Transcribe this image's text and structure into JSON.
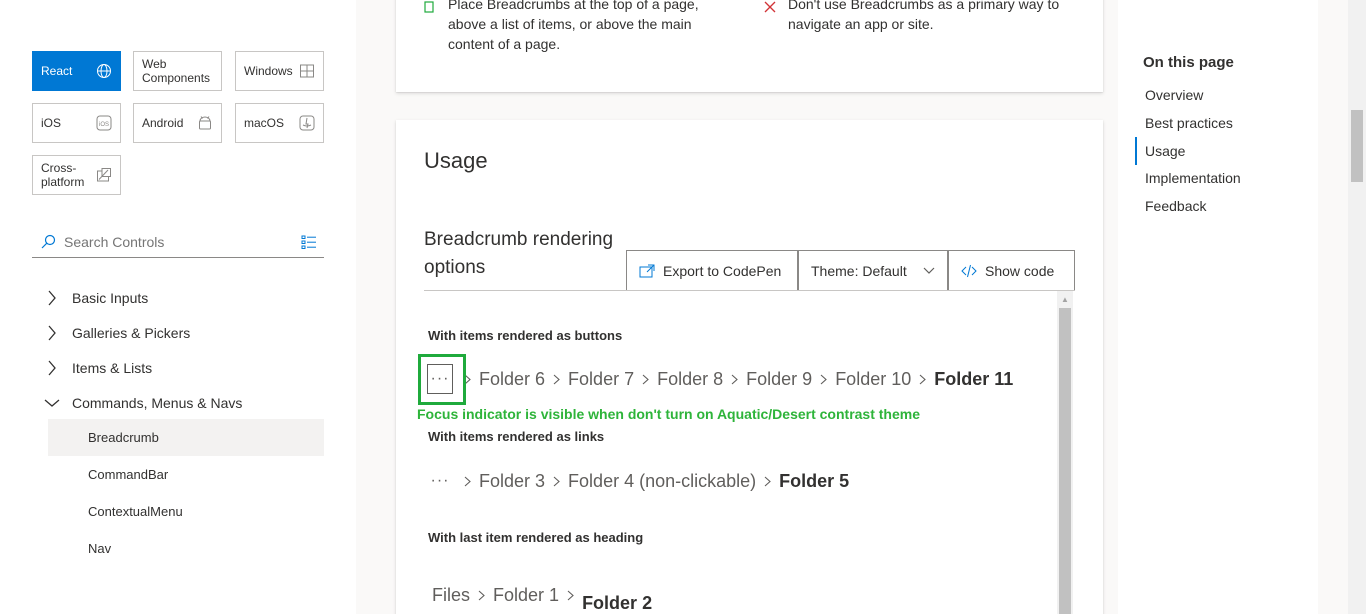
{
  "platforms": [
    {
      "label": "React",
      "icon": "globe-icon",
      "active": true
    },
    {
      "label": "Web Components",
      "icon": "",
      "active": false
    },
    {
      "label": "Windows",
      "icon": "windows-icon",
      "active": false
    },
    {
      "label": "iOS",
      "icon": "ios-icon",
      "active": false
    },
    {
      "label": "Android",
      "icon": "android-icon",
      "active": false
    },
    {
      "label": "macOS",
      "icon": "macos-icon",
      "active": false
    },
    {
      "label": "Cross-platform",
      "icon": "cross-platform-icon",
      "active": false
    }
  ],
  "search": {
    "placeholder": "Search Controls"
  },
  "categories": [
    {
      "label": "Basic Inputs",
      "expanded": false
    },
    {
      "label": "Galleries & Pickers",
      "expanded": false
    },
    {
      "label": "Items & Lists",
      "expanded": false
    },
    {
      "label": "Commands, Menus & Navs",
      "expanded": true
    }
  ],
  "sub_items": [
    "Breadcrumb",
    "CommandBar",
    "ContextualMenu",
    "Nav"
  ],
  "best_practices": {
    "do_text": "Place Breadcrumbs at the top of a page, above a list of items, or above the main content of a page.",
    "dont_text": "Don't use Breadcrumbs as a primary way to navigate an app or site."
  },
  "usage": {
    "heading": "Usage",
    "example_title": "Breadcrumb rendering options",
    "export_label": "Export to CodePen",
    "theme_label": "Theme: Default",
    "show_code_label": "Show code"
  },
  "demo": {
    "section1_label": "With items rendered as buttons",
    "section1_items": [
      "Folder 6",
      "Folder 7",
      "Folder 8",
      "Folder 9",
      "Folder 10"
    ],
    "section1_last": "Folder 11",
    "overflow_glyph": "···",
    "annotation": "Focus indicator is visible when don't turn on Aquatic/Desert contrast theme",
    "section2_label": "With items rendered as links",
    "section2_items": [
      "Folder 3",
      "Folder 4 (non-clickable)"
    ],
    "section2_last": "Folder 5",
    "section3_label": "With last item rendered as heading",
    "section3_items": [
      "Files",
      "Folder 1"
    ],
    "section3_last": "Folder 2"
  },
  "toc": {
    "title": "On this page",
    "items": [
      "Overview",
      "Best practices",
      "Usage",
      "Implementation",
      "Feedback"
    ],
    "current": "Usage"
  },
  "colors": {
    "accent": "#0078d4",
    "annotation": "#2eb43a",
    "focus_box": "#1faa3c"
  }
}
